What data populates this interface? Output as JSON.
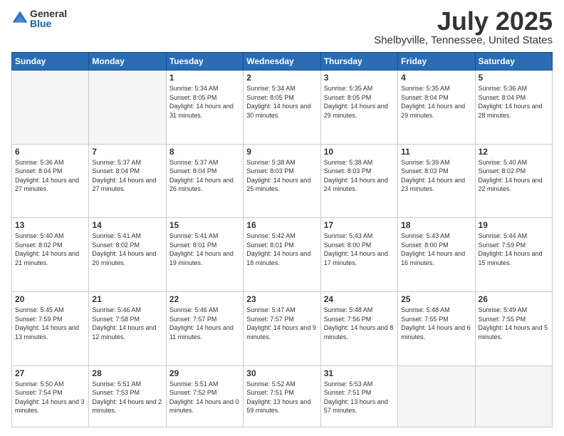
{
  "logo": {
    "general": "General",
    "blue": "Blue"
  },
  "header": {
    "month": "July 2025",
    "location": "Shelbyville, Tennessee, United States"
  },
  "days_of_week": [
    "Sunday",
    "Monday",
    "Tuesday",
    "Wednesday",
    "Thursday",
    "Friday",
    "Saturday"
  ],
  "weeks": [
    [
      {
        "day": "",
        "info": ""
      },
      {
        "day": "",
        "info": ""
      },
      {
        "day": "1",
        "info": "Sunrise: 5:34 AM\nSunset: 8:05 PM\nDaylight: 14 hours and 31 minutes."
      },
      {
        "day": "2",
        "info": "Sunrise: 5:34 AM\nSunset: 8:05 PM\nDaylight: 14 hours and 30 minutes."
      },
      {
        "day": "3",
        "info": "Sunrise: 5:35 AM\nSunset: 8:05 PM\nDaylight: 14 hours and 29 minutes."
      },
      {
        "day": "4",
        "info": "Sunrise: 5:35 AM\nSunset: 8:04 PM\nDaylight: 14 hours and 29 minutes."
      },
      {
        "day": "5",
        "info": "Sunrise: 5:36 AM\nSunset: 8:04 PM\nDaylight: 14 hours and 28 minutes."
      }
    ],
    [
      {
        "day": "6",
        "info": "Sunrise: 5:36 AM\nSunset: 8:04 PM\nDaylight: 14 hours and 27 minutes."
      },
      {
        "day": "7",
        "info": "Sunrise: 5:37 AM\nSunset: 8:04 PM\nDaylight: 14 hours and 27 minutes."
      },
      {
        "day": "8",
        "info": "Sunrise: 5:37 AM\nSunset: 8:04 PM\nDaylight: 14 hours and 26 minutes."
      },
      {
        "day": "9",
        "info": "Sunrise: 5:38 AM\nSunset: 8:03 PM\nDaylight: 14 hours and 25 minutes."
      },
      {
        "day": "10",
        "info": "Sunrise: 5:38 AM\nSunset: 8:03 PM\nDaylight: 14 hours and 24 minutes."
      },
      {
        "day": "11",
        "info": "Sunrise: 5:39 AM\nSunset: 8:03 PM\nDaylight: 14 hours and 23 minutes."
      },
      {
        "day": "12",
        "info": "Sunrise: 5:40 AM\nSunset: 8:02 PM\nDaylight: 14 hours and 22 minutes."
      }
    ],
    [
      {
        "day": "13",
        "info": "Sunrise: 5:40 AM\nSunset: 8:02 PM\nDaylight: 14 hours and 21 minutes."
      },
      {
        "day": "14",
        "info": "Sunrise: 5:41 AM\nSunset: 8:02 PM\nDaylight: 14 hours and 20 minutes."
      },
      {
        "day": "15",
        "info": "Sunrise: 5:41 AM\nSunset: 8:01 PM\nDaylight: 14 hours and 19 minutes."
      },
      {
        "day": "16",
        "info": "Sunrise: 5:42 AM\nSunset: 8:01 PM\nDaylight: 14 hours and 18 minutes."
      },
      {
        "day": "17",
        "info": "Sunrise: 5:43 AM\nSunset: 8:00 PM\nDaylight: 14 hours and 17 minutes."
      },
      {
        "day": "18",
        "info": "Sunrise: 5:43 AM\nSunset: 8:00 PM\nDaylight: 14 hours and 16 minutes."
      },
      {
        "day": "19",
        "info": "Sunrise: 5:44 AM\nSunset: 7:59 PM\nDaylight: 14 hours and 15 minutes."
      }
    ],
    [
      {
        "day": "20",
        "info": "Sunrise: 5:45 AM\nSunset: 7:59 PM\nDaylight: 14 hours and 13 minutes."
      },
      {
        "day": "21",
        "info": "Sunrise: 5:46 AM\nSunset: 7:58 PM\nDaylight: 14 hours and 12 minutes."
      },
      {
        "day": "22",
        "info": "Sunrise: 5:46 AM\nSunset: 7:57 PM\nDaylight: 14 hours and 11 minutes."
      },
      {
        "day": "23",
        "info": "Sunrise: 5:47 AM\nSunset: 7:57 PM\nDaylight: 14 hours and 9 minutes."
      },
      {
        "day": "24",
        "info": "Sunrise: 5:48 AM\nSunset: 7:56 PM\nDaylight: 14 hours and 8 minutes."
      },
      {
        "day": "25",
        "info": "Sunrise: 5:48 AM\nSunset: 7:55 PM\nDaylight: 14 hours and 6 minutes."
      },
      {
        "day": "26",
        "info": "Sunrise: 5:49 AM\nSunset: 7:55 PM\nDaylight: 14 hours and 5 minutes."
      }
    ],
    [
      {
        "day": "27",
        "info": "Sunrise: 5:50 AM\nSunset: 7:54 PM\nDaylight: 14 hours and 3 minutes."
      },
      {
        "day": "28",
        "info": "Sunrise: 5:51 AM\nSunset: 7:53 PM\nDaylight: 14 hours and 2 minutes."
      },
      {
        "day": "29",
        "info": "Sunrise: 5:51 AM\nSunset: 7:52 PM\nDaylight: 14 hours and 0 minutes."
      },
      {
        "day": "30",
        "info": "Sunrise: 5:52 AM\nSunset: 7:51 PM\nDaylight: 13 hours and 59 minutes."
      },
      {
        "day": "31",
        "info": "Sunrise: 5:53 AM\nSunset: 7:51 PM\nDaylight: 13 hours and 57 minutes."
      },
      {
        "day": "",
        "info": ""
      },
      {
        "day": "",
        "info": ""
      }
    ]
  ]
}
